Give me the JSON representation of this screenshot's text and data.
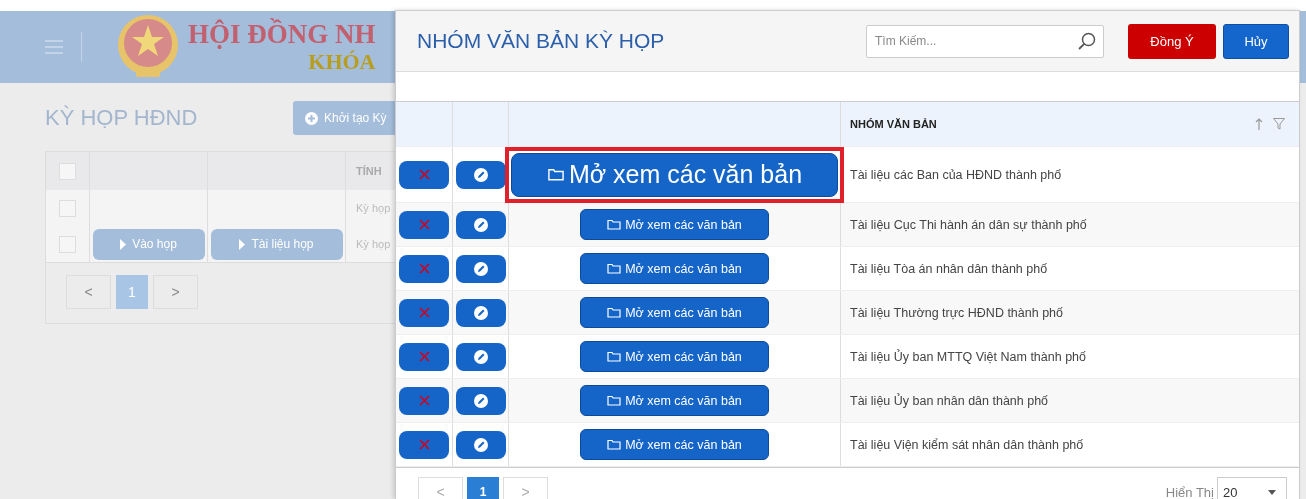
{
  "background_page": {
    "header": {
      "title_line1": "HỘI ĐỒNG NH",
      "title_line2": "KHÓA"
    },
    "page_title": "KỲ HỌP HĐND",
    "create_button": "Khởi tạo Kỳ",
    "table": {
      "header_checked": false,
      "column_4": "TÍNH",
      "rows": [
        {
          "checked": false,
          "buttons": [],
          "text": "Kỳ họp"
        },
        {
          "checked": false,
          "buttons": [
            "Vào họp",
            "Tài liệu họp"
          ],
          "text": "Kỳ họp"
        }
      ]
    },
    "pagination": {
      "prev": "<",
      "page": "1",
      "next": ">"
    }
  },
  "dialog": {
    "title": "NHÓM VĂN BẢN KỲ HỌP",
    "search": {
      "placeholder": "Tìm Kiếm..."
    },
    "confirm_button": "Đồng Ý",
    "cancel_button": "Hủy",
    "table": {
      "column_4": "NHÓM VĂN BẢN",
      "rows": [
        {
          "open_button": "Mở xem các văn bản",
          "name": "Tài liệu các Ban của HĐND thành phố",
          "highlighted": true
        },
        {
          "open_button": "Mở xem các văn bản",
          "name": "Tài liệu Cục Thi hành án dân sự thành phố",
          "highlighted": false
        },
        {
          "open_button": "Mở xem các văn bản",
          "name": "Tài liệu Tòa án nhân dân thành phố",
          "highlighted": false
        },
        {
          "open_button": "Mở xem các văn bản",
          "name": "Tài liệu Thường trực HĐND thành phố",
          "highlighted": false
        },
        {
          "open_button": "Mở xem các văn bản",
          "name": "Tài liệu Ủy ban MTTQ Việt Nam thành phố",
          "highlighted": false
        },
        {
          "open_button": "Mở xem các văn bản",
          "name": "Tài liệu Ủy ban nhân dân thành phố",
          "highlighted": false
        },
        {
          "open_button": "Mở xem các văn bản",
          "name": "Tài liệu Viện kiểm sát nhân dân thành phố",
          "highlighted": false
        }
      ]
    },
    "pagination": {
      "prev": "<",
      "page": "1",
      "next": ">",
      "page_size_label": "Hiển Thị",
      "page_size": "20"
    }
  }
}
